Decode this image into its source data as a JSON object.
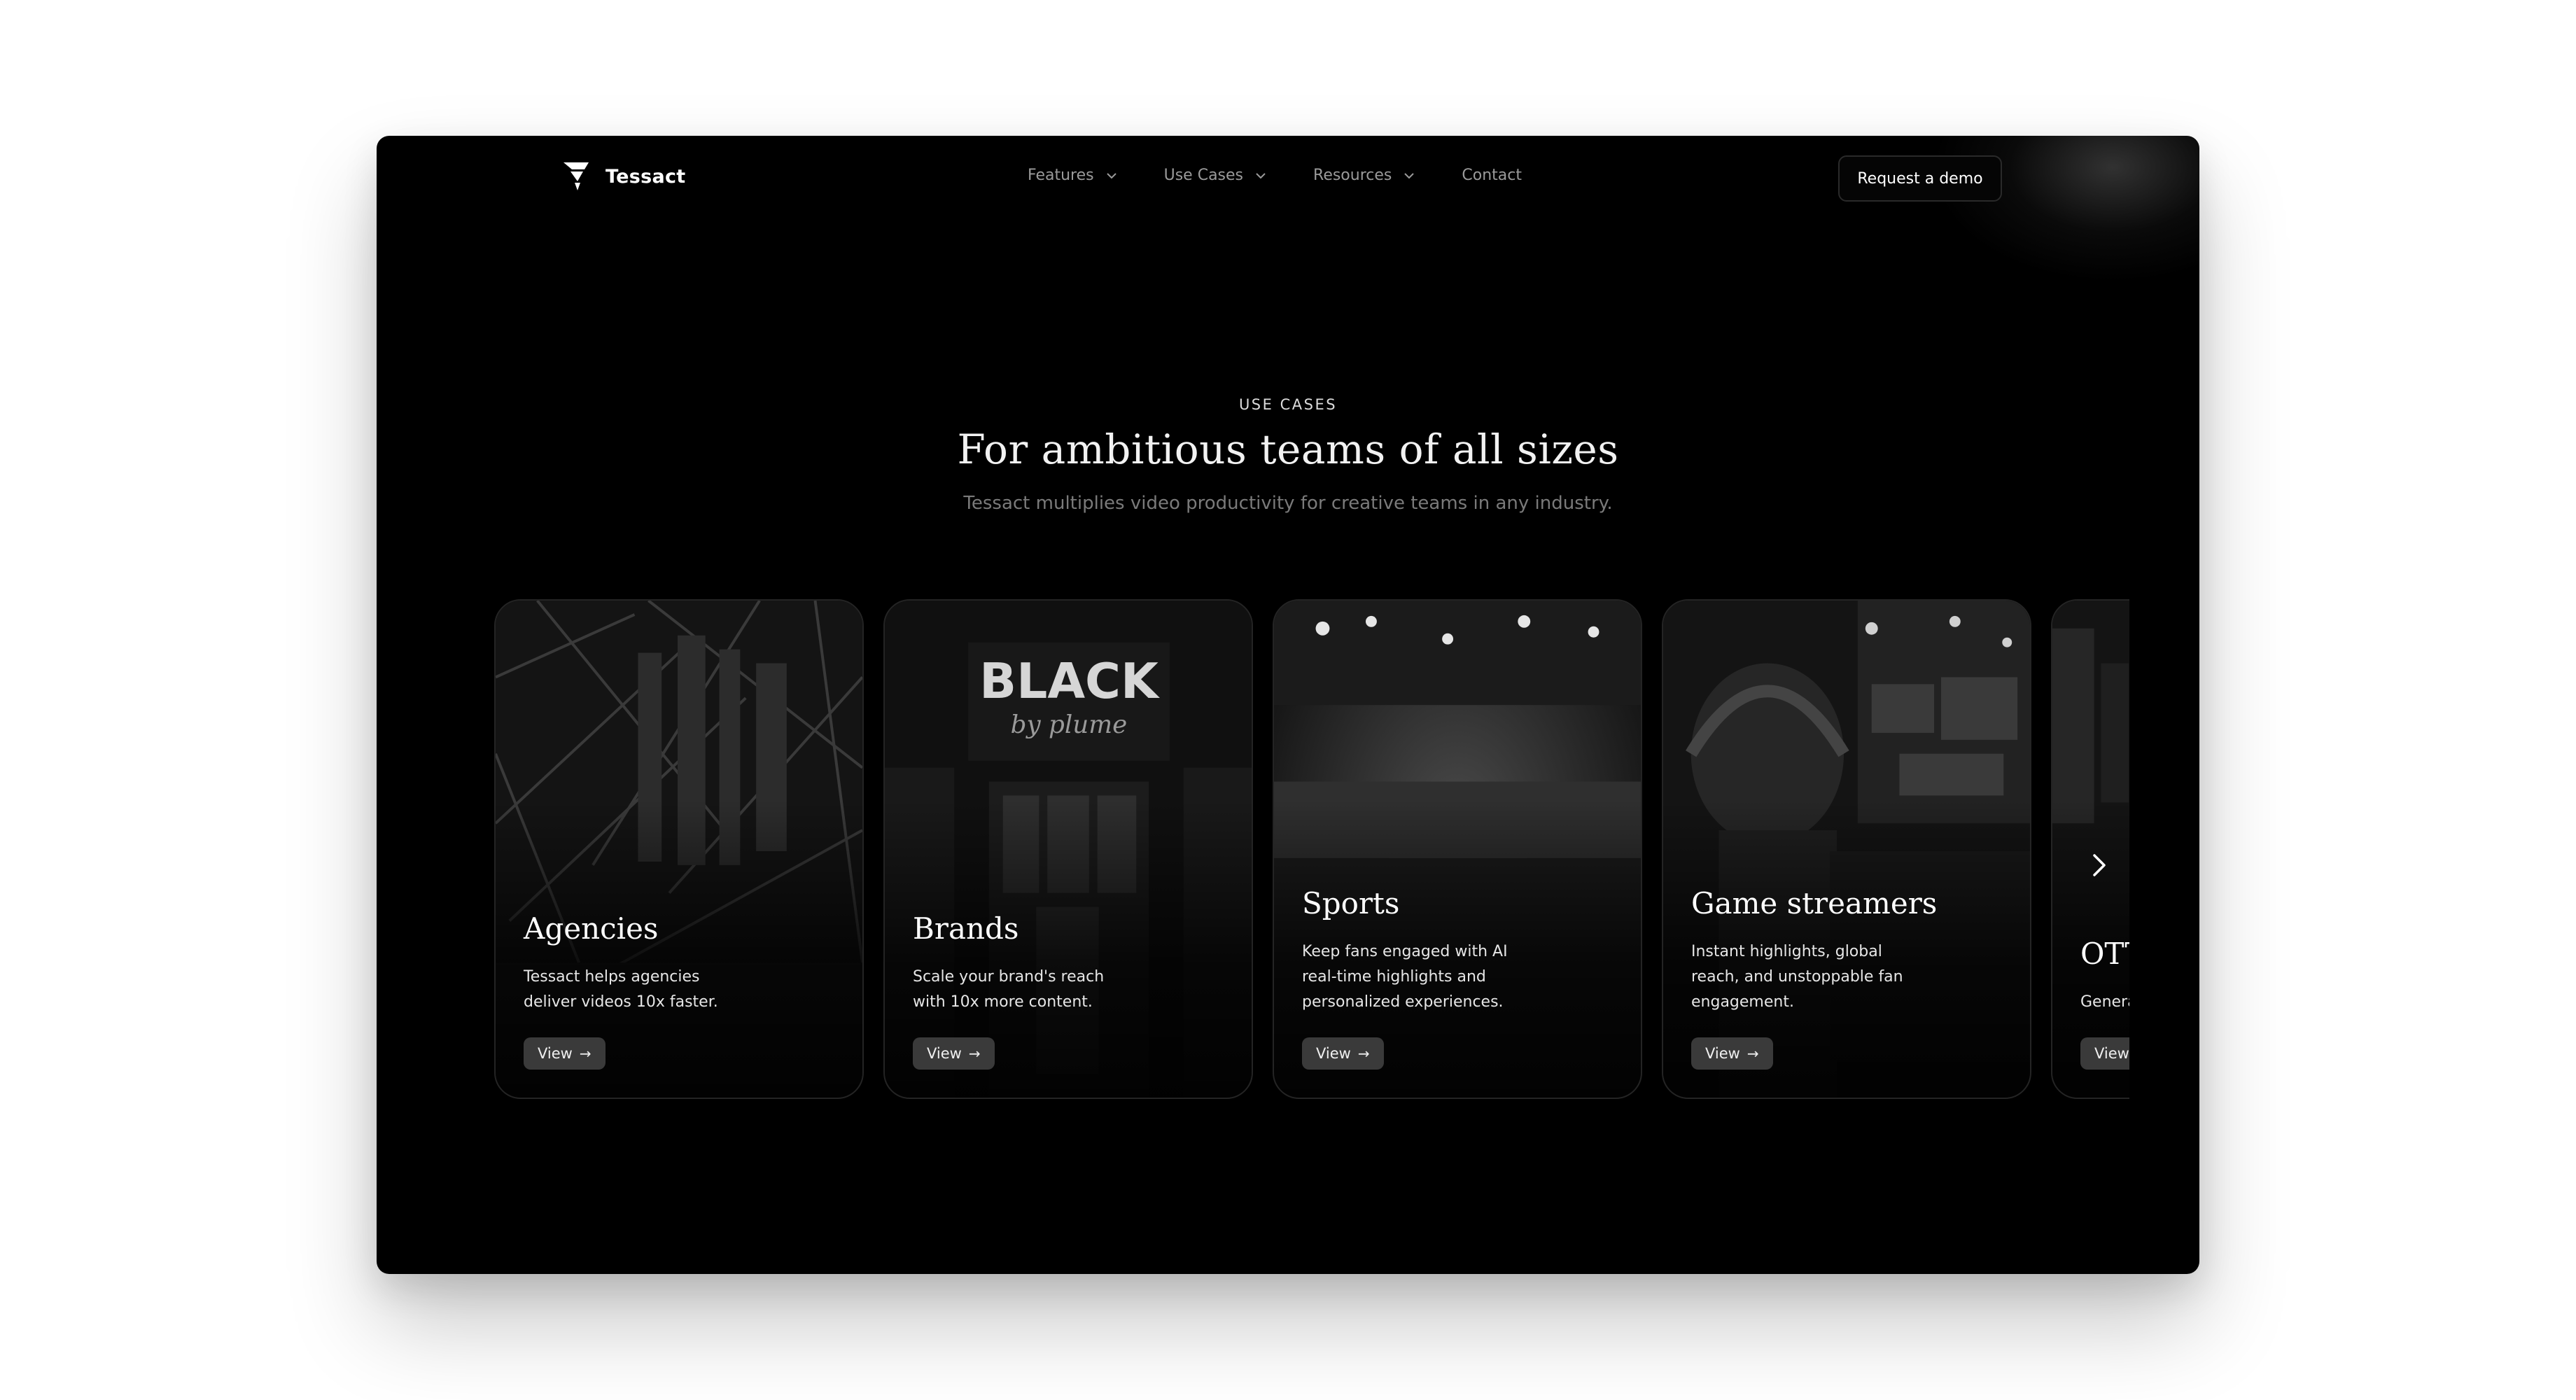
{
  "header": {
    "brand": "Tessact",
    "nav": [
      {
        "label": "Features",
        "has_dropdown": true
      },
      {
        "label": "Use Cases",
        "has_dropdown": true
      },
      {
        "label": "Resources",
        "has_dropdown": true
      },
      {
        "label": "Contact",
        "has_dropdown": false
      }
    ],
    "cta_label": "Request  a demo"
  },
  "hero": {
    "eyebrow": "USE CASES",
    "title": "For ambitious teams of all sizes",
    "subtitle": "Tessact multiplies video productivity for creative teams in any industry."
  },
  "cards": [
    {
      "title": "Agencies",
      "description": "Tessact helps agencies deliver videos 10x faster.",
      "button": "View",
      "image": "abstract-architecture-image"
    },
    {
      "title": "Brands",
      "description": "Scale your brand's reach with 10x more content.",
      "button": "View",
      "image": "storefront-image",
      "sign_text": "BLACK",
      "sign_script": "by plume"
    },
    {
      "title": "Sports",
      "description": "Keep fans engaged with AI real-time highlights and personalized experiences.",
      "button": "View",
      "image": "stadium-image"
    },
    {
      "title": "Game streamers",
      "description": "Instant highlights, global reach, and unstoppable fan engagement.",
      "button": "View",
      "image": "gamer-headset-image"
    },
    {
      "title": "OTT",
      "description": "Generate edits to",
      "button": "View",
      "image": "ott-image"
    }
  ],
  "icons": {
    "dropdown": "chevron-down-icon",
    "arrow": "arrow-right-icon",
    "next": "chevron-right-icon"
  },
  "colors": {
    "background": "#000000",
    "page": "#ffffff",
    "card_border": "#242424",
    "button": "#3a3a3a"
  }
}
